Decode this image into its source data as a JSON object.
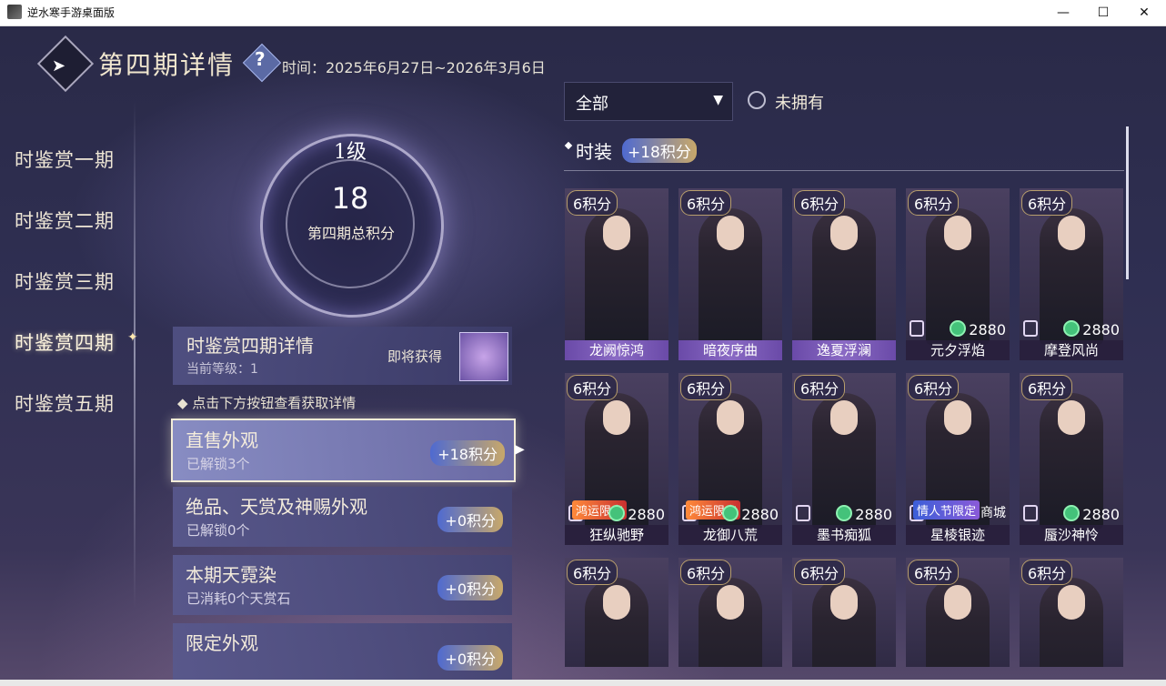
{
  "window": {
    "title": "逆水寒手游桌面版",
    "minimize": "—",
    "maximize": "☐",
    "close": "✕"
  },
  "header": {
    "title": "第四期详情",
    "help": "?",
    "period": "时间：2025年6月27日~2026年3月6日"
  },
  "nav": {
    "items": [
      "时鉴赏一期",
      "时鉴赏二期",
      "时鉴赏三期",
      "时鉴赏四期",
      "时鉴赏五期"
    ],
    "active_index": 3
  },
  "level": {
    "label": "1级",
    "score": "18",
    "score_label": "第四期总积分"
  },
  "detail": {
    "title": "时鉴赏四期详情",
    "current_level": "当前等级：1",
    "coming_soon": "即将获得"
  },
  "hint": "◆ 点击下方按钮查看获取详情",
  "categories": [
    {
      "title": "直售外观",
      "sub": "已解锁3个",
      "points": "+18积分"
    },
    {
      "title": "绝品、天赏及神赐外观",
      "sub": "已解锁0个",
      "points": "+0积分"
    },
    {
      "title": "本期天霓染",
      "sub": "已消耗0个天赏石",
      "points": "+0积分"
    },
    {
      "title": "限定外观",
      "sub": "",
      "points": "+0积分"
    }
  ],
  "filter": {
    "value": "全部",
    "unowned_label": "未拥有"
  },
  "section": {
    "title": "时装",
    "points": "+18积分"
  },
  "costumes": [
    {
      "name": "龙阙惊鸿",
      "pts": "6积分",
      "price": "",
      "tag": "",
      "shop": "",
      "owned": true
    },
    {
      "name": "暗夜序曲",
      "pts": "6积分",
      "price": "",
      "tag": "",
      "shop": "",
      "owned": true
    },
    {
      "name": "逸夏浮澜",
      "pts": "6积分",
      "price": "",
      "tag": "",
      "shop": "",
      "owned": true
    },
    {
      "name": "元夕浮焰",
      "pts": "6积分",
      "price": "2880",
      "tag": "",
      "shop": "",
      "owned": false
    },
    {
      "name": "摩登风尚",
      "pts": "6积分",
      "price": "2880",
      "tag": "",
      "shop": "",
      "owned": false
    },
    {
      "name": "狂纵驰野",
      "pts": "6积分",
      "price": "2880",
      "tag": "鸿运限定",
      "shop": "",
      "owned": false
    },
    {
      "name": "龙御八荒",
      "pts": "6积分",
      "price": "2880",
      "tag": "鸿运限定",
      "shop": "",
      "owned": false
    },
    {
      "name": "墨书痴狐",
      "pts": "6积分",
      "price": "2880",
      "tag": "",
      "shop": "",
      "owned": false
    },
    {
      "name": "星棱银迹",
      "pts": "6积分",
      "price": "",
      "tag": "情人节限定",
      "shop": "商城",
      "owned": false
    },
    {
      "name": "蜃沙神怜",
      "pts": "6积分",
      "price": "2880",
      "tag": "",
      "shop": "",
      "owned": false
    },
    {
      "name": "",
      "pts": "6积分",
      "price": "",
      "tag": "",
      "shop": "",
      "owned": false
    },
    {
      "name": "",
      "pts": "6积分",
      "price": "",
      "tag": "",
      "shop": "",
      "owned": false
    },
    {
      "name": "",
      "pts": "6积分",
      "price": "",
      "tag": "",
      "shop": "",
      "owned": false
    },
    {
      "name": "",
      "pts": "6积分",
      "price": "",
      "tag": "",
      "shop": "",
      "owned": false
    },
    {
      "name": "",
      "pts": "6积分",
      "price": "",
      "tag": "",
      "shop": "",
      "owned": false
    }
  ]
}
